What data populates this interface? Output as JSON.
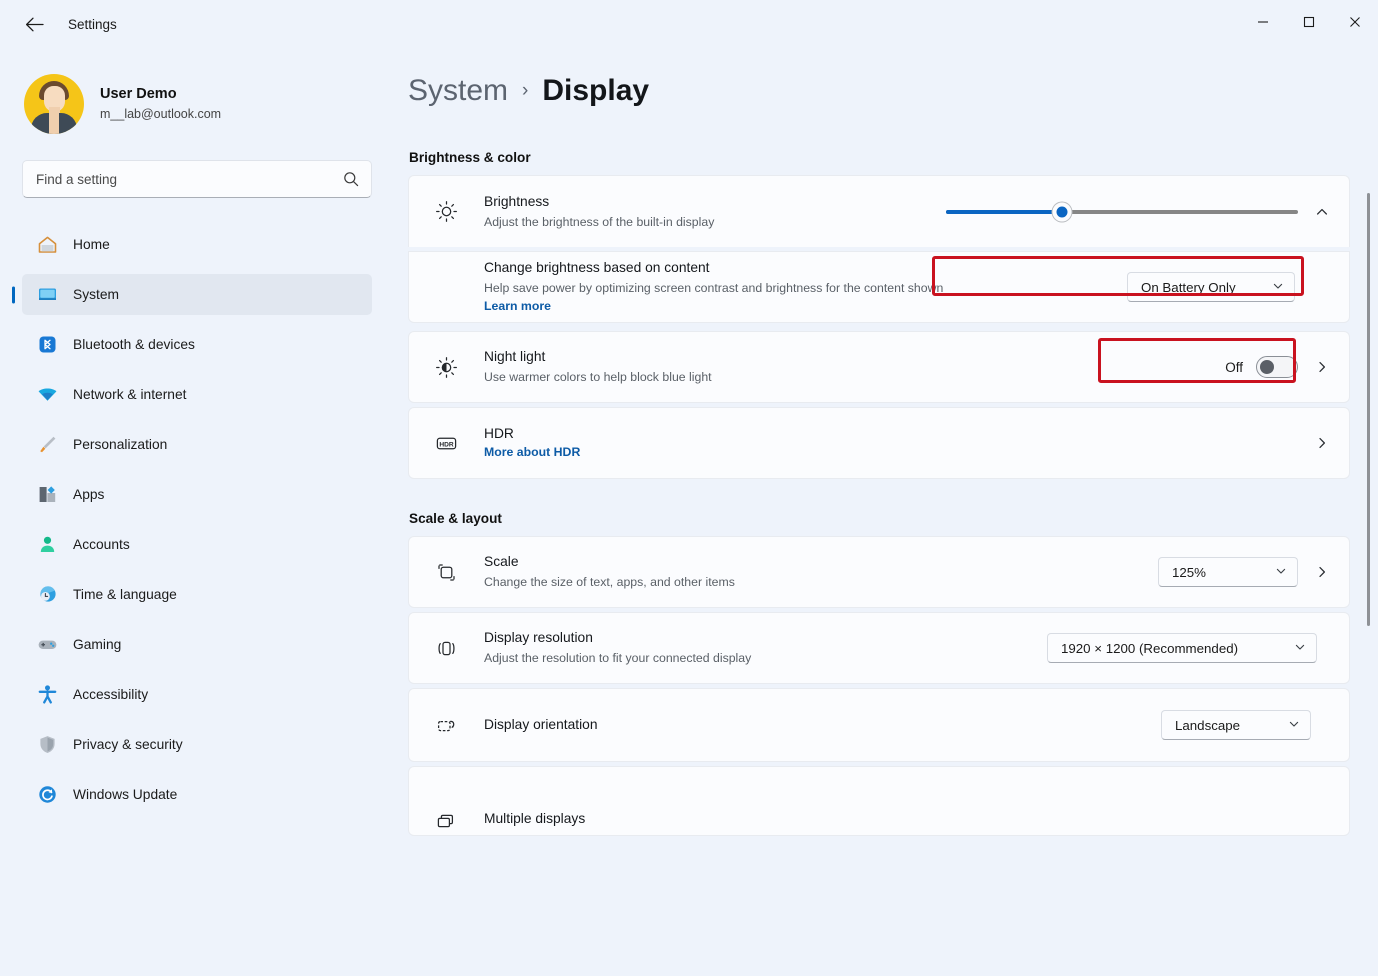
{
  "window": {
    "app_title": "Settings",
    "back_icon": "arrow-left-icon",
    "controls": {
      "minimize": "minimize-icon",
      "maximize": "maximize-icon",
      "close": "close-icon"
    }
  },
  "sidebar": {
    "profile": {
      "name": "User Demo",
      "email": "m__lab@outlook.com",
      "avatar_color": "#f5c518"
    },
    "search": {
      "placeholder": "Find a setting",
      "value": "",
      "icon": "search-icon"
    },
    "items": [
      {
        "label": "Home",
        "icon": "home-icon",
        "selected": false
      },
      {
        "label": "System",
        "icon": "monitor-icon",
        "selected": true
      },
      {
        "label": "Bluetooth & devices",
        "icon": "bluetooth-icon",
        "selected": false
      },
      {
        "label": "Network & internet",
        "icon": "wifi-icon",
        "selected": false
      },
      {
        "label": "Personalization",
        "icon": "brush-icon",
        "selected": false
      },
      {
        "label": "Apps",
        "icon": "apps-icon",
        "selected": false
      },
      {
        "label": "Accounts",
        "icon": "person-icon",
        "selected": false
      },
      {
        "label": "Time & language",
        "icon": "clock-globe-icon",
        "selected": false
      },
      {
        "label": "Gaming",
        "icon": "gamepad-icon",
        "selected": false
      },
      {
        "label": "Accessibility",
        "icon": "accessibility-icon",
        "selected": false
      },
      {
        "label": "Privacy & security",
        "icon": "shield-icon",
        "selected": false
      },
      {
        "label": "Windows Update",
        "icon": "update-icon",
        "selected": false
      }
    ],
    "accent_color": "#0067c0",
    "selected_bg": "#e1e7f0"
  },
  "breadcrumb": {
    "parent": "System",
    "separator": "›",
    "current": "Display"
  },
  "sections": [
    {
      "id": "brightness-color",
      "title": "Brightness & color"
    },
    {
      "id": "scale-layout",
      "title": "Scale & layout"
    }
  ],
  "brightness_row": {
    "title": "Brightness",
    "subtitle": "Adjust the brightness of the built-in display",
    "icon": "sun-icon",
    "slider": {
      "value": 33,
      "min": 0,
      "max": 100,
      "fill_color": "#0a65c2",
      "track_color": "#868686"
    },
    "expand_icon": "chevron-up-icon",
    "highlighted": true
  },
  "content_brightness_row": {
    "title": "Change brightness based on content",
    "subtitle": "Help save power by optimizing screen contrast and brightness for the content shown",
    "link": "Learn more",
    "dropdown_value": "On Battery Only",
    "dropdown_icon": "chevron-down-icon",
    "highlighted": true
  },
  "night_light_row": {
    "title": "Night light",
    "subtitle": "Use warmer colors to help block blue light",
    "icon": "night-light-icon",
    "toggle_state": "Off",
    "toggle_on": false,
    "chevron": "chevron-right-icon"
  },
  "hdr_row": {
    "title": "HDR",
    "link": "More about HDR",
    "icon": "hdr-icon",
    "chevron": "chevron-right-icon"
  },
  "scale_row": {
    "title": "Scale",
    "subtitle": "Change the size of text, apps, and other items",
    "icon": "scale-icon",
    "dropdown_value": "125%",
    "dropdown_icon": "chevron-down-icon",
    "chevron": "chevron-right-icon"
  },
  "resolution_row": {
    "title": "Display resolution",
    "subtitle": "Adjust the resolution to fit your connected display",
    "icon": "resolution-icon",
    "dropdown_value": "1920 × 1200 (Recommended)",
    "dropdown_icon": "chevron-down-icon"
  },
  "orientation_row": {
    "title": "Display orientation",
    "icon": "orientation-icon",
    "dropdown_value": "Landscape",
    "dropdown_icon": "chevron-down-icon"
  },
  "multiple_displays_row": {
    "title": "Multiple displays",
    "icon": "multiple-displays-icon",
    "dropdown_icon": "chevron-down-icon"
  },
  "annotation_color": "#c9121f"
}
